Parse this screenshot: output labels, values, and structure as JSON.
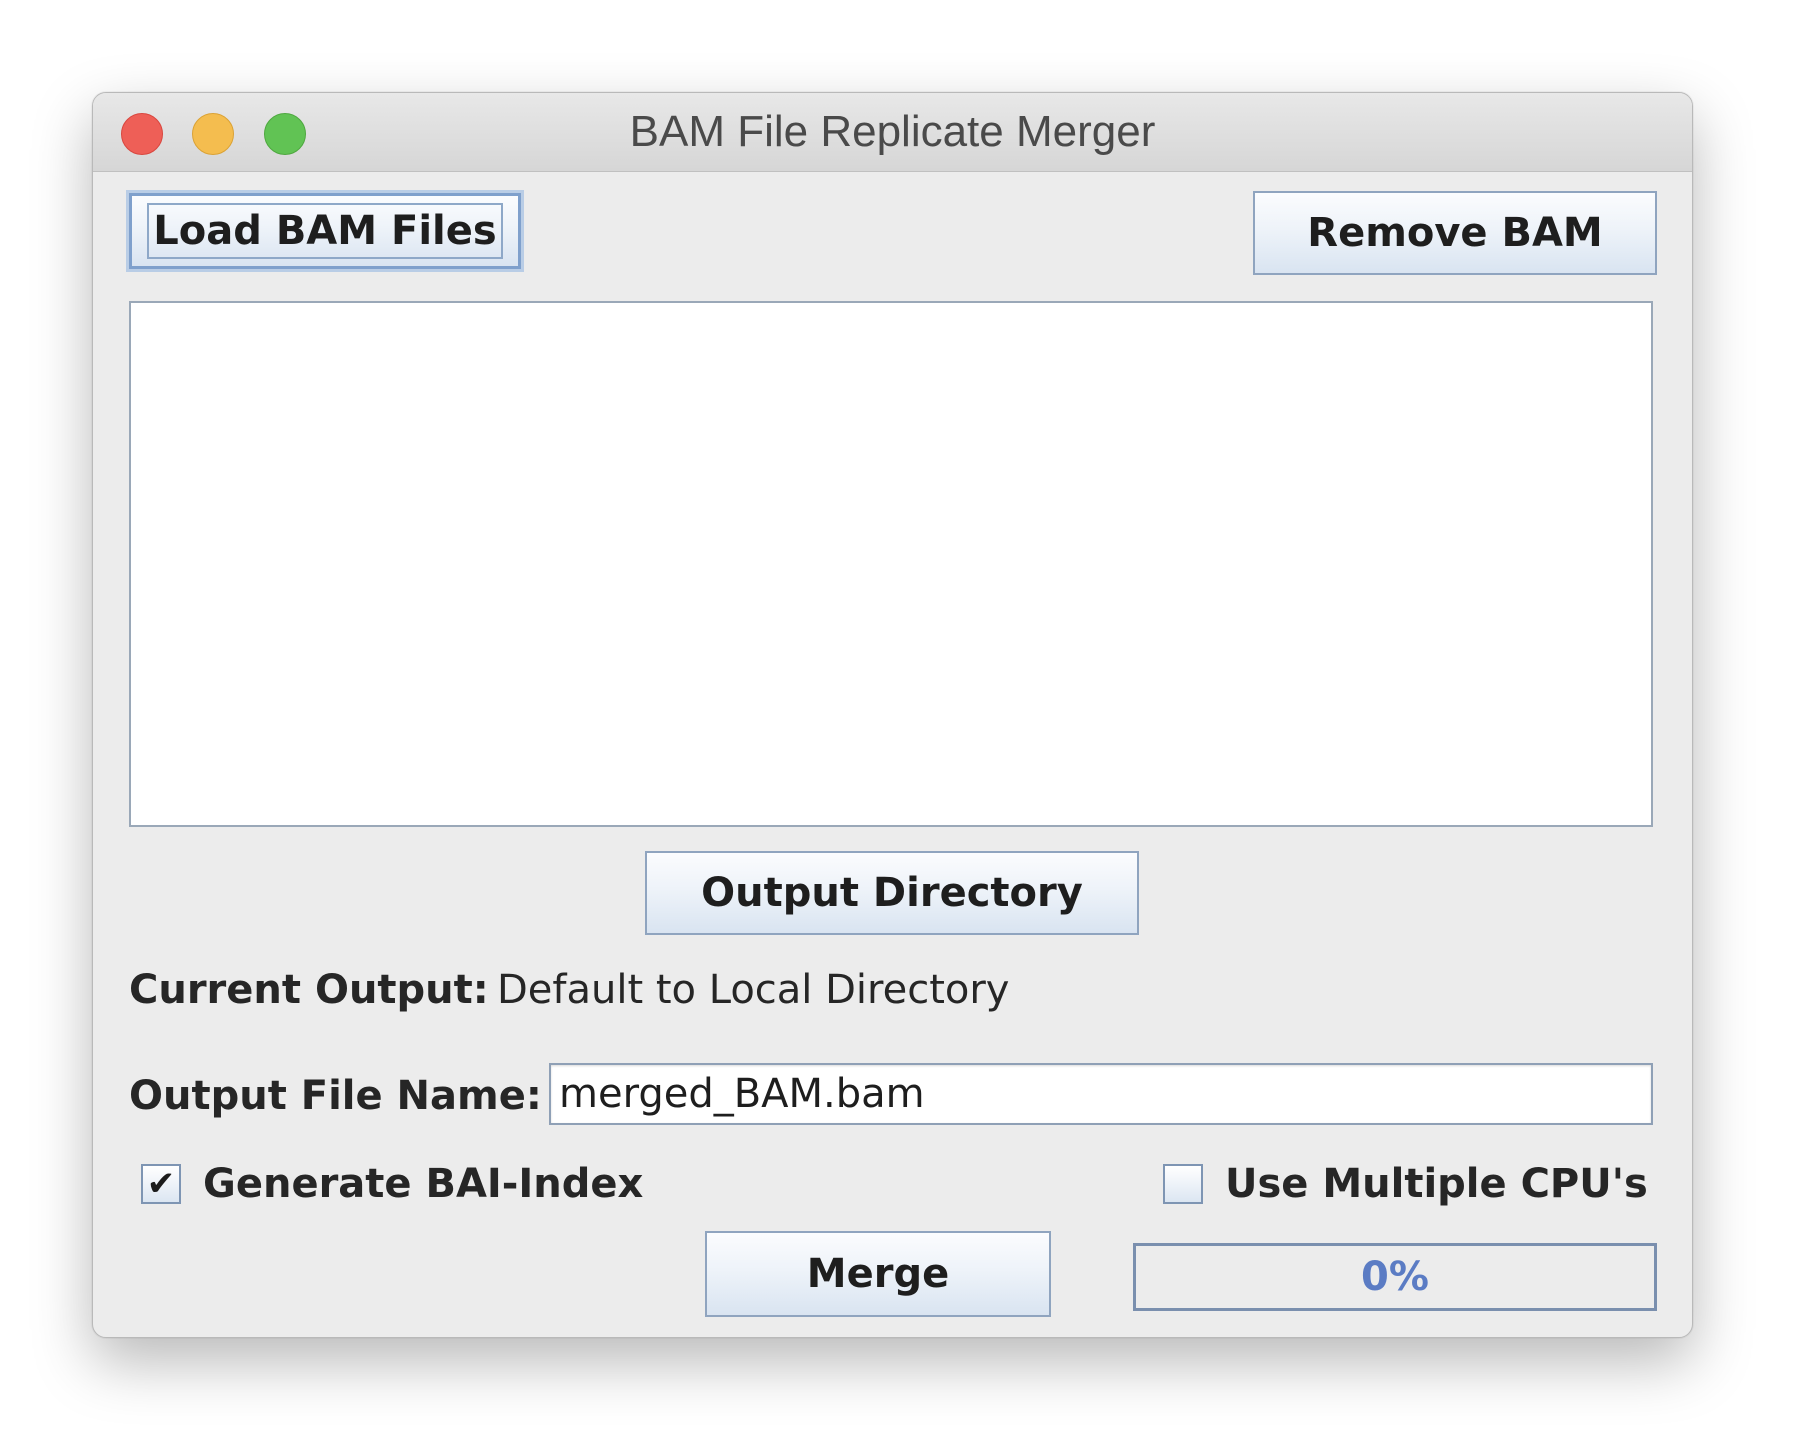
{
  "window": {
    "title": "BAM File Replicate Merger"
  },
  "buttons": {
    "load_bam": "Load BAM Files",
    "remove_bam": "Remove BAM",
    "output_directory": "Output Directory",
    "merge": "Merge"
  },
  "file_list": {
    "items": []
  },
  "current_output": {
    "label": "Current Output:",
    "value": "Default to Local Directory"
  },
  "output_file_name": {
    "label": "Output File Name:",
    "value": "merged_BAM.bam"
  },
  "options": {
    "generate_bai": {
      "label": "Generate BAI-Index",
      "checked": true
    },
    "multiple_cpus": {
      "label": "Use Multiple CPU's",
      "checked": false
    }
  },
  "progress": {
    "value": 0,
    "text": "0%"
  },
  "colors": {
    "close": "#ee5f57",
    "minimize": "#f4bd4f",
    "maximize": "#61c354",
    "progress_text": "#5b7cc4"
  }
}
